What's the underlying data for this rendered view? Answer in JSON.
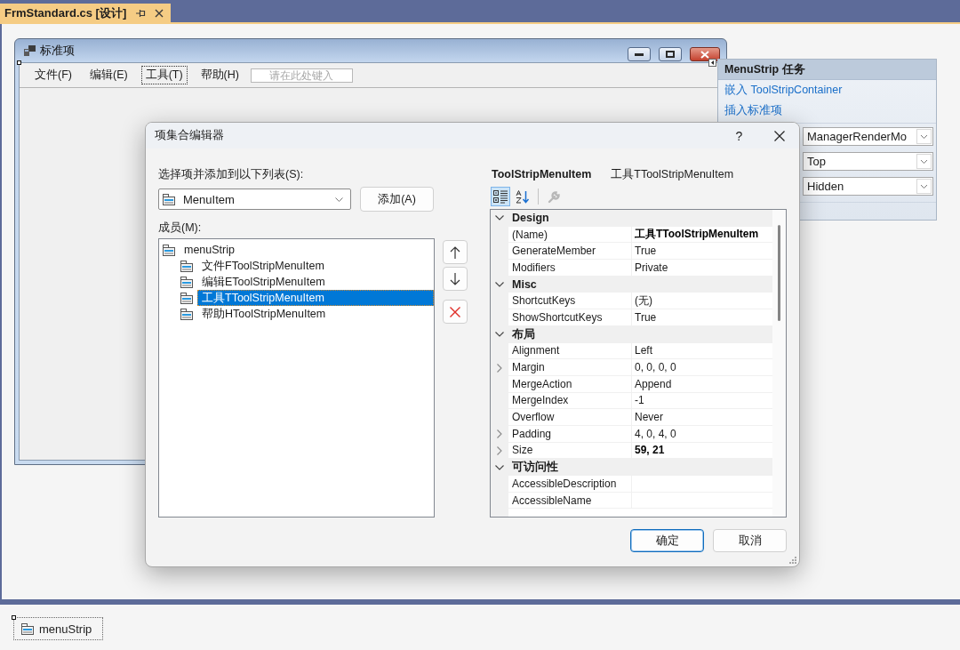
{
  "document_tab": {
    "title": "FrmStandard.cs [设计]"
  },
  "form": {
    "title": "标准项",
    "menu": [
      {
        "label": "文件(F)",
        "selected": false
      },
      {
        "label": "编辑(E)",
        "selected": false
      },
      {
        "label": "工具(T)",
        "selected": true
      },
      {
        "label": "帮助(H)",
        "selected": false
      }
    ],
    "new_item": {
      "placeholder": "请在此处键入"
    }
  },
  "smart_tag_panel": {
    "title": "MenuStrip 任务",
    "links": [
      "嵌入 ToolStripContainer",
      "插入标准项"
    ],
    "dropdowns": [
      {
        "value": "ManagerRenderMo"
      },
      {
        "value": "Top"
      },
      {
        "value": "Hidden"
      }
    ]
  },
  "dialog": {
    "title": "项集合编辑器",
    "help_button": "?",
    "add_label": "选择项并添加到以下列表(S):",
    "item_type": "MenuItem",
    "add_button": "添加(A)",
    "members_label": "成员(M):",
    "members": {
      "label": "menuStrip",
      "selected": false,
      "children": [
        {
          "label": "文件FToolStripMenuItem",
          "selected": false
        },
        {
          "label": "编辑EToolStripMenuItem",
          "selected": false
        },
        {
          "label": "工具TToolStripMenuItem",
          "selected": true
        },
        {
          "label": "帮助HToolStripMenuItem",
          "selected": false
        }
      ]
    },
    "properties_type": "ToolStripMenuItem",
    "properties_object": "工具TToolStripMenuItem",
    "property_toolbar": [
      {
        "kind": "categorized",
        "selected": true,
        "disabled": false
      },
      {
        "kind": "alphabetical",
        "selected": false,
        "disabled": false
      },
      {
        "kind": "property_pages",
        "selected": false,
        "disabled": true
      }
    ],
    "property_grid": [
      {
        "category": "Design",
        "expanded": true,
        "properties": [
          {
            "name": "(Name)",
            "value": "工具TToolStripMenuItem",
            "modified": true,
            "expandable": false
          },
          {
            "name": "GenerateMember",
            "value": "True",
            "modified": false,
            "expandable": false
          },
          {
            "name": "Modifiers",
            "value": "Private",
            "modified": false,
            "expandable": false
          }
        ]
      },
      {
        "category": "Misc",
        "expanded": true,
        "properties": [
          {
            "name": "ShortcutKeys",
            "value": "(无)",
            "modified": false,
            "expandable": false
          },
          {
            "name": "ShowShortcutKeys",
            "value": "True",
            "modified": false,
            "expandable": false
          }
        ]
      },
      {
        "category": "布局",
        "expanded": true,
        "properties": [
          {
            "name": "Alignment",
            "value": "Left",
            "modified": false,
            "expandable": false
          },
          {
            "name": "Margin",
            "value": "0, 0, 0, 0",
            "modified": false,
            "expandable": true
          },
          {
            "name": "MergeAction",
            "value": "Append",
            "modified": false,
            "expandable": false
          },
          {
            "name": "MergeIndex",
            "value": "-1",
            "modified": false,
            "expandable": false
          },
          {
            "name": "Overflow",
            "value": "Never",
            "modified": false,
            "expandable": false
          },
          {
            "name": "Padding",
            "value": "4, 0, 4, 0",
            "modified": false,
            "expandable": true
          },
          {
            "name": "Size",
            "value": "59, 21",
            "modified": true,
            "expandable": true
          }
        ]
      },
      {
        "category": "可访问性",
        "expanded": true,
        "properties": [
          {
            "name": "AccessibleDescription",
            "expandable": false
          },
          {
            "name": "AccessibleName",
            "expandable": false
          }
        ]
      }
    ],
    "buttons": [
      {
        "label": "确定",
        "default": true
      },
      {
        "label": "取消",
        "default": false
      }
    ]
  },
  "component_tray": [
    {
      "label": "menuStrip"
    }
  ]
}
